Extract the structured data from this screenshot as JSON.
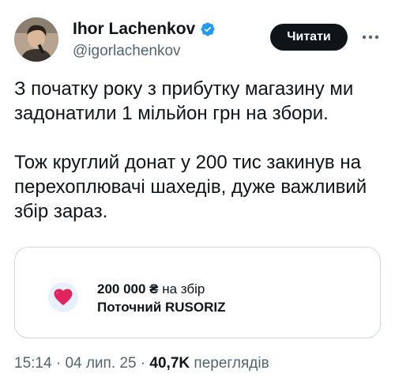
{
  "author": {
    "display_name": "Ihor Lachenkov",
    "handle": "@igorlachenkov",
    "verified": true,
    "verified_color": "#1d9bf0"
  },
  "actions": {
    "follow_label": "Читати",
    "more_icon": "more-horizontal-icon"
  },
  "tweet": {
    "paragraphs": [
      "З початку року з прибутку магазину ми задонатили 1 мільйон грн на збори.",
      "Тож круглий донат у 200 тис закинув на перехоплювачі шахедів, дуже важливий збір зараз."
    ]
  },
  "card": {
    "icon": "heart-icon",
    "amount": "200 000 ₴",
    "amount_suffix": " на збір",
    "subtitle": "Поточний RUSORIZ"
  },
  "meta": {
    "time": "15:14",
    "separator1": " · ",
    "date": "04 лип. 25",
    "separator2": " · ",
    "views_count": "40,7K",
    "views_label": " переглядів"
  },
  "colors": {
    "text": "#0f1419",
    "secondary_text": "#536471",
    "border": "#cfd9de",
    "button_bg": "#0f1419",
    "heart": "#e0245e"
  }
}
